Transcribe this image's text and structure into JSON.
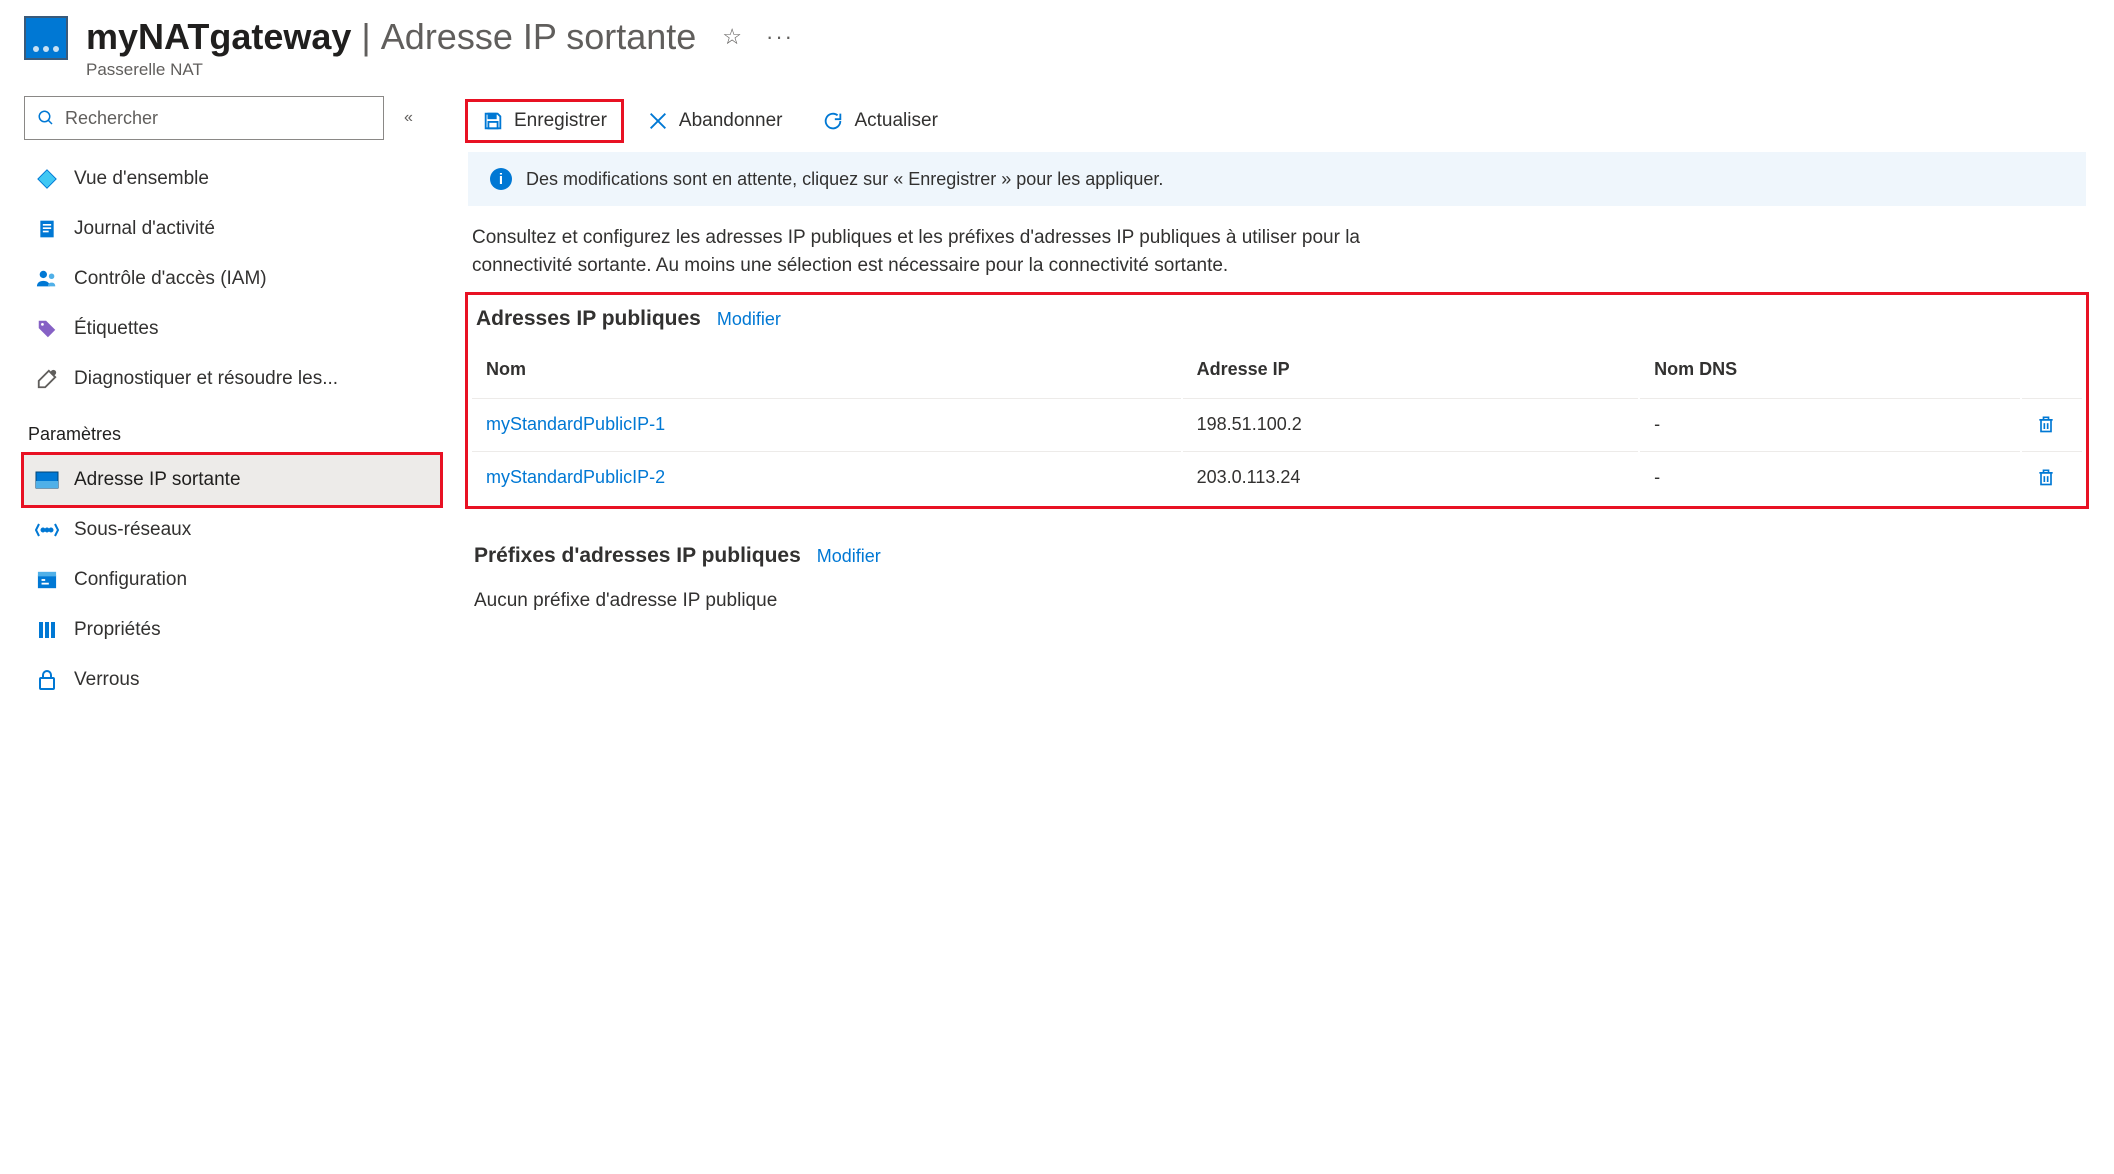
{
  "header": {
    "resourceName": "myNATgateway",
    "pageTitle": "Adresse IP sortante",
    "subtitle": "Passerelle NAT"
  },
  "sidebar": {
    "searchPlaceholder": "Rechercher",
    "items": [
      {
        "label": "Vue d'ensemble"
      },
      {
        "label": "Journal d'activité"
      },
      {
        "label": "Contrôle d'accès (IAM)"
      },
      {
        "label": "Étiquettes"
      },
      {
        "label": "Diagnostiquer et résoudre les..."
      }
    ],
    "groupLabel": "Paramètres",
    "settingsItems": [
      {
        "label": "Adresse IP sortante",
        "active": true
      },
      {
        "label": "Sous-réseaux"
      },
      {
        "label": "Configuration"
      },
      {
        "label": "Propriétés"
      },
      {
        "label": "Verrous"
      }
    ]
  },
  "toolbar": {
    "save": "Enregistrer",
    "discard": "Abandonner",
    "refresh": "Actualiser"
  },
  "banner": {
    "text": "Des modifications sont en attente, cliquez sur « Enregistrer » pour les appliquer."
  },
  "intro": "Consultez et configurez les adresses IP publiques et les préfixes d'adresses IP publiques à utiliser pour la connectivité sortante. Au moins une sélection est nécessaire pour la connectivité sortante.",
  "publicIps": {
    "heading": "Adresses IP publiques",
    "modify": "Modifier",
    "cols": {
      "name": "Nom",
      "ip": "Adresse IP",
      "dns": "Nom DNS"
    },
    "rows": [
      {
        "name": "myStandardPublicIP-1",
        "ip": "198.51.100.2",
        "dns": "-"
      },
      {
        "name": "myStandardPublicIP-2",
        "ip": "203.0.113.24",
        "dns": "-"
      }
    ]
  },
  "prefixes": {
    "heading": "Préfixes d'adresses IP publiques",
    "modify": "Modifier",
    "empty": "Aucun préfixe d'adresse IP publique"
  }
}
